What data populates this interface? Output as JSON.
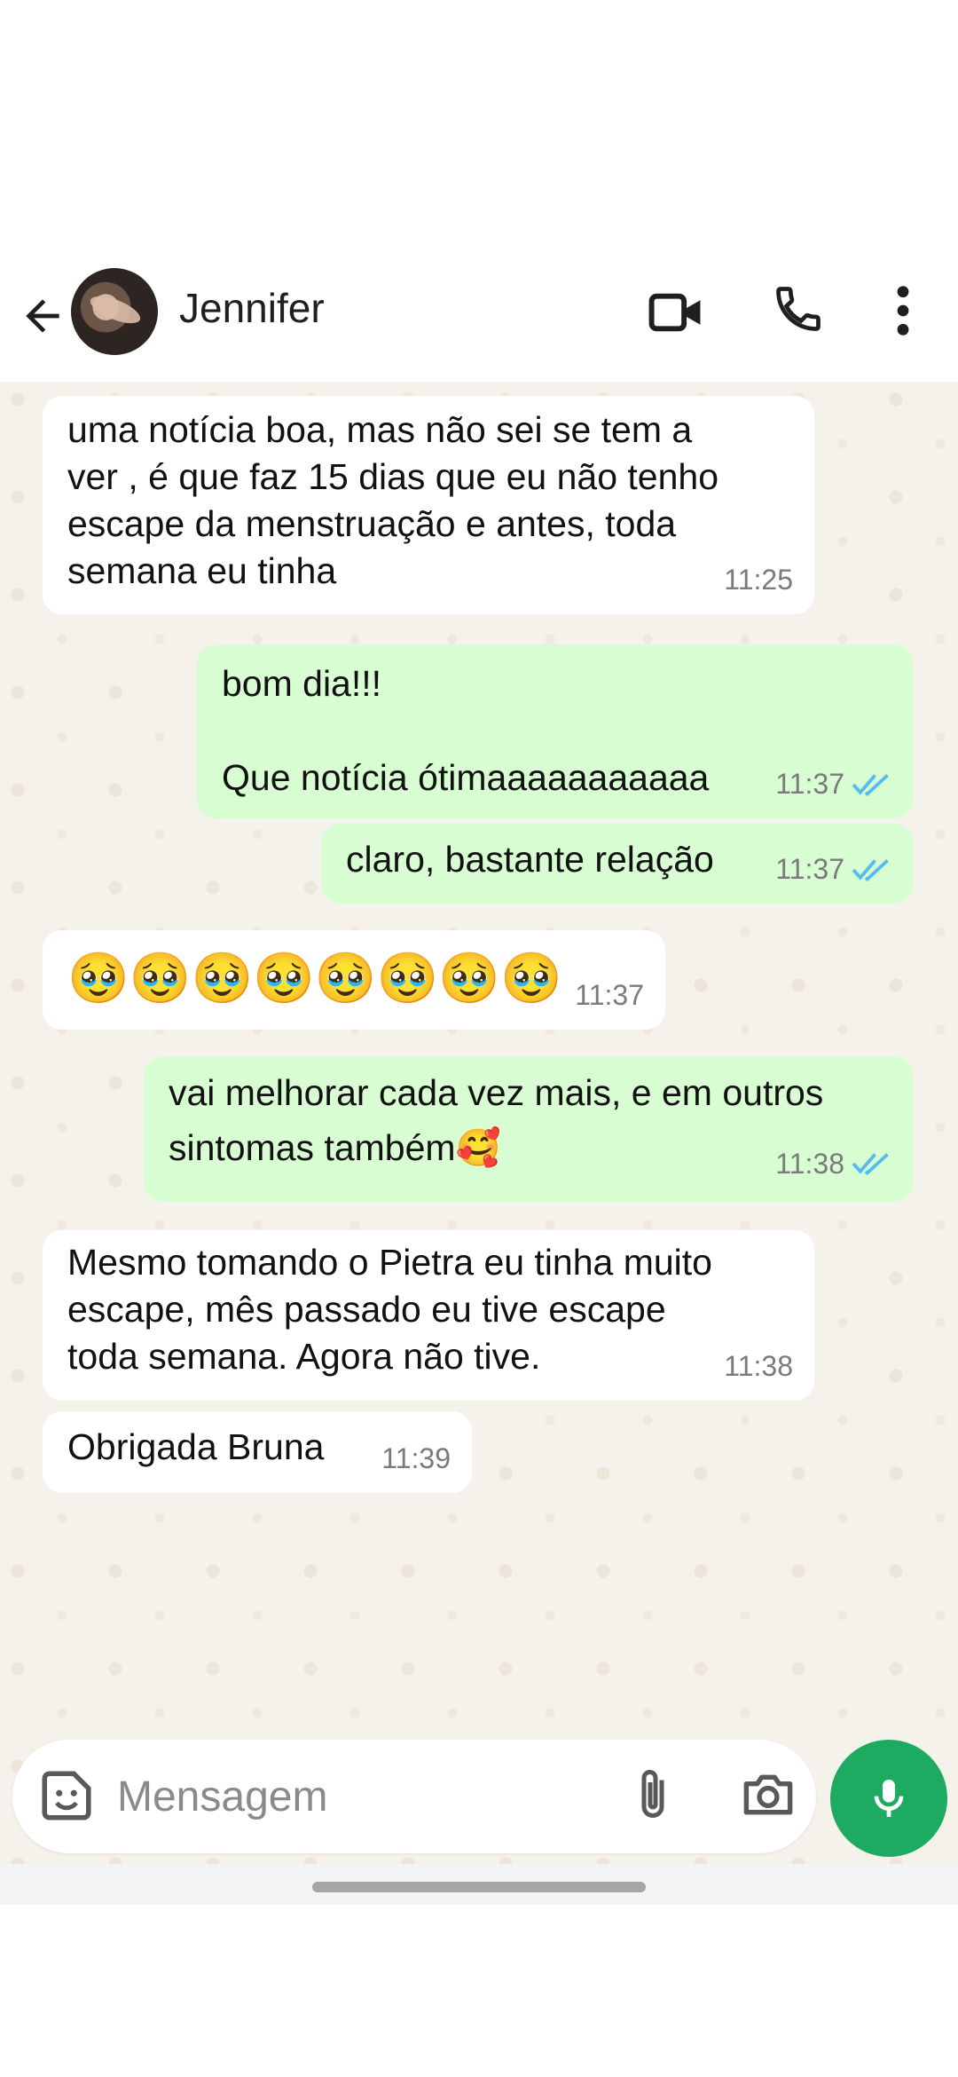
{
  "header": {
    "contact_name": "Jennifer",
    "icons": [
      "back-arrow-icon",
      "avatar",
      "video-call-icon",
      "voice-call-icon",
      "more-vert-icon"
    ]
  },
  "messages": [
    {
      "direction": "in",
      "text": "uma notícia boa, mas não sei se tem a\nver , é que faz 15 dias que eu não tenho\nescape da menstruação e antes, toda\nsemana eu tinha",
      "time": "11:25"
    },
    {
      "direction": "out",
      "text": "bom dia!!!\n\nQue notícia ótimaaaaaaaaaaa",
      "time": "11:37",
      "status": "read"
    },
    {
      "direction": "out",
      "text": "claro, bastante relação",
      "time": "11:37",
      "status": "read"
    },
    {
      "direction": "in",
      "text": "🥹🥹🥹🥹🥹🥹🥹🥹",
      "time": "11:37"
    },
    {
      "direction": "out",
      "text": "vai melhorar cada vez mais, e em outros\nsintomas também🥰",
      "time": "11:38",
      "status": "read"
    },
    {
      "direction": "in",
      "text": "Mesmo tomando o Pietra eu tinha muito\nescape, mês passado eu tive escape\ntoda semana. Agora não tive.",
      "time": "11:38"
    },
    {
      "direction": "in",
      "text": "Obrigada Bruna",
      "time": "11:39"
    }
  ],
  "composer": {
    "placeholder": "Mensagem",
    "icons": [
      "sticker-icon",
      "attach-icon",
      "camera-icon",
      "mic-icon"
    ]
  },
  "colors": {
    "incoming_bubble": "#ffffff",
    "outgoing_bubble": "#d9fdd3",
    "read_ticks": "#53bdeb",
    "mic_button": "#1dab61",
    "wallpaper": "#f5f1eb"
  }
}
